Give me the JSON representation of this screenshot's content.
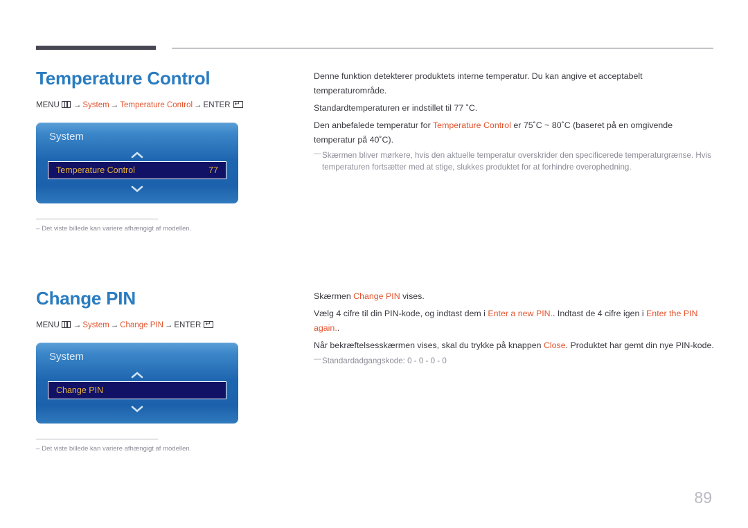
{
  "page": {
    "number": "89",
    "language": "da"
  },
  "sections": [
    {
      "id": "temperature-control",
      "title": "Temperature Control",
      "menu_path": {
        "menu_label": "MENU",
        "menu_icon": "menu-grid-icon",
        "arrow": "→",
        "step1": "System",
        "step2": "Temperature Control",
        "enter_label": "ENTER",
        "enter_icon": "enter-return-icon"
      },
      "osd": {
        "title": "System",
        "chevron_up_icon": "chevron-up-icon",
        "chevron_down_icon": "chevron-down-icon",
        "row_label": "Temperature Control",
        "row_value": "77"
      },
      "left_note": {
        "dash": "–",
        "text": "Det viste billede kan variere afhængigt af modellen."
      },
      "body": [
        {
          "parts": [
            {
              "t": "Denne funktion detekterer produktets interne temperatur. Du kan angive et acceptabelt temperaturområde.",
              "hl": false
            }
          ]
        },
        {
          "parts": [
            {
              "t": "Standardtemperaturen er indstillet til 77 ˚C.",
              "hl": false
            }
          ]
        },
        {
          "parts": [
            {
              "t": "Den anbefalede temperatur for ",
              "hl": false
            },
            {
              "t": "Temperature Control",
              "hl": true
            },
            {
              "t": " er 75˚C ~ 80˚C (baseret på en omgivende temperatur på 40˚C).",
              "hl": false
            }
          ]
        }
      ],
      "note": {
        "dash": "—",
        "text": "Skærmen bliver mørkere, hvis den aktuelle temperatur overskrider den specificerede temperaturgrænse. Hvis temperaturen fortsætter med at stige, slukkes produktet for at forhindre overophedning."
      }
    },
    {
      "id": "change-pin",
      "title": "Change PIN",
      "menu_path": {
        "menu_label": "MENU",
        "menu_icon": "menu-grid-icon",
        "arrow": "→",
        "step1": "System",
        "step2": "Change PIN",
        "enter_label": "ENTER",
        "enter_icon": "enter-return-icon"
      },
      "osd": {
        "title": "System",
        "chevron_up_icon": "chevron-up-icon",
        "chevron_down_icon": "chevron-down-icon",
        "row_label": "Change PIN",
        "row_value": ""
      },
      "left_note": {
        "dash": "–",
        "text": "Det viste billede kan variere afhængigt af modellen."
      },
      "body": [
        {
          "parts": [
            {
              "t": "Skærmen ",
              "hl": false
            },
            {
              "t": "Change PIN",
              "hl": true
            },
            {
              "t": " vises.",
              "hl": false
            }
          ]
        },
        {
          "parts": [
            {
              "t": "Vælg 4 cifre til din PIN-kode, og indtast dem i ",
              "hl": false
            },
            {
              "t": "Enter a new PIN.",
              "hl": true
            },
            {
              "t": ". Indtast de 4 cifre igen i ",
              "hl": false
            },
            {
              "t": "Enter the PIN again.",
              "hl": true
            },
            {
              "t": ".",
              "hl": false
            }
          ]
        },
        {
          "parts": [
            {
              "t": "Når bekræftelsesskærmen vises, skal du trykke på knappen ",
              "hl": false
            },
            {
              "t": "Close",
              "hl": true
            },
            {
              "t": ". Produktet har gemt din nye PIN-kode.",
              "hl": false
            }
          ]
        }
      ],
      "note": {
        "dash": "—",
        "text": "Standardadgangskode: 0 - 0 - 0 - 0"
      }
    }
  ],
  "colors": {
    "heading_blue": "#2a7cc0",
    "link_orange": "#e2542f",
    "osd_blue_top": "#5a9fd8",
    "osd_blue_bottom": "#1c61ab",
    "osd_row_navy": "#111165",
    "osd_row_gold": "#e8b43c",
    "rule_dark": "#474754",
    "note_gray": "#8d8d98",
    "page_number_gray": "#b9b9c4"
  }
}
